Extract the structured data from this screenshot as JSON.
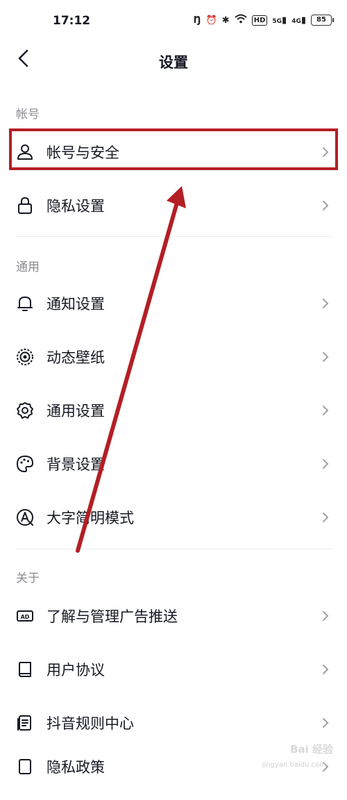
{
  "status_bar": {
    "time": "17:12",
    "network_labels": [
      "5G",
      "4G"
    ],
    "hd_label": "HD",
    "battery": "85"
  },
  "header": {
    "title": "设置",
    "back_icon": "chevron-left-icon"
  },
  "sections": [
    {
      "label": "帐号",
      "items": [
        {
          "label": "帐号与安全",
          "icon": "user-icon",
          "highlighted": true
        },
        {
          "label": "隐私设置",
          "icon": "lock-icon"
        }
      ]
    },
    {
      "label": "通用",
      "items": [
        {
          "label": "通知设置",
          "icon": "bell-icon"
        },
        {
          "label": "动态壁纸",
          "icon": "live-wallpaper-icon"
        },
        {
          "label": "通用设置",
          "icon": "gear-icon"
        },
        {
          "label": "背景设置",
          "icon": "palette-icon"
        },
        {
          "label": "大字简明模式",
          "icon": "font-size-icon"
        }
      ]
    },
    {
      "label": "关于",
      "items": [
        {
          "label": "了解与管理广告推送",
          "icon": "ad-icon"
        },
        {
          "label": "用户协议",
          "icon": "book-icon"
        },
        {
          "label": "抖音规则中心",
          "icon": "rules-doc-icon"
        },
        {
          "label": "隐私政策",
          "icon": "privacy-doc-icon"
        }
      ]
    }
  ],
  "watermark": {
    "text": "Bai 经验",
    "sub": "jingyan.baidu.com"
  },
  "colors": {
    "highlight": "#b31f24",
    "text": "#161823",
    "muted": "#8a8b91"
  }
}
